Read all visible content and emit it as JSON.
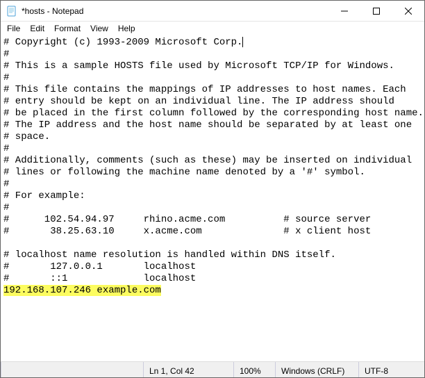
{
  "window": {
    "title": "*hosts - Notepad"
  },
  "menu": {
    "file": "File",
    "edit": "Edit",
    "format": "Format",
    "view": "View",
    "help": "Help"
  },
  "editor": {
    "before_caret": "# Copyright (c) 1993-2009 Microsoft Corp.",
    "middle": "\n#\n# This is a sample HOSTS file used by Microsoft TCP/IP for Windows.\n#\n# This file contains the mappings of IP addresses to host names. Each\n# entry should be kept on an individual line. The IP address should\n# be placed in the first column followed by the corresponding host name.\n# The IP address and the host name should be separated by at least one\n# space.\n#\n# Additionally, comments (such as these) may be inserted on individual\n# lines or following the machine name denoted by a '#' symbol.\n#\n# For example:\n#\n#      102.54.94.97     rhino.acme.com          # source server\n#       38.25.63.10     x.acme.com              # x client host\n\n# localhost name resolution is handled within DNS itself.\n#       127.0.0.1       localhost\n#       ::1             localhost\n",
    "highlighted": "192.168.107.246 example.com"
  },
  "status": {
    "position": "Ln 1, Col 42",
    "zoom": "100%",
    "line_ending": "Windows (CRLF)",
    "encoding": "UTF-8"
  }
}
